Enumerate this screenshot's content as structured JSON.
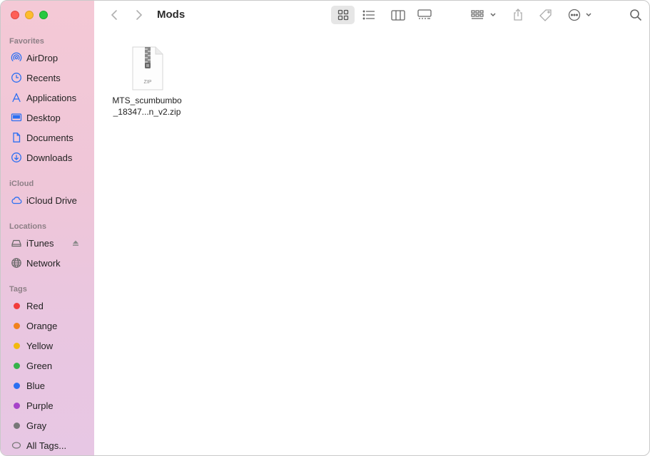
{
  "window": {
    "title": "Mods"
  },
  "sidebar": {
    "favorites_title": "Favorites",
    "favorites": [
      {
        "label": "AirDrop",
        "icon": "airdrop-icon"
      },
      {
        "label": "Recents",
        "icon": "clock-icon"
      },
      {
        "label": "Applications",
        "icon": "applications-icon"
      },
      {
        "label": "Desktop",
        "icon": "desktop-icon"
      },
      {
        "label": "Documents",
        "icon": "document-icon"
      },
      {
        "label": "Downloads",
        "icon": "download-icon"
      }
    ],
    "icloud_title": "iCloud",
    "icloud": [
      {
        "label": "iCloud Drive",
        "icon": "cloud-icon"
      }
    ],
    "locations_title": "Locations",
    "locations": [
      {
        "label": "iTunes",
        "icon": "drive-icon"
      },
      {
        "label": "Network",
        "icon": "globe-icon"
      }
    ],
    "tags_title": "Tags",
    "tags": [
      {
        "label": "Red",
        "color": "#f23b3b"
      },
      {
        "label": "Orange",
        "color": "#f0821e"
      },
      {
        "label": "Yellow",
        "color": "#f2b90f"
      },
      {
        "label": "Green",
        "color": "#36b24a"
      },
      {
        "label": "Blue",
        "color": "#2b6ff2"
      },
      {
        "label": "Purple",
        "color": "#a742c9"
      },
      {
        "label": "Gray",
        "color": "#777777"
      },
      {
        "label": "All Tags...",
        "icon": "all-tags-icon"
      }
    ]
  },
  "files": [
    {
      "name_line1": "MTS_scumbumbo",
      "name_line2": "_18347...n_v2.zip",
      "badge": "ZIP",
      "icon": "zip-file-icon"
    }
  ],
  "accent_color": "#2b6ff2"
}
